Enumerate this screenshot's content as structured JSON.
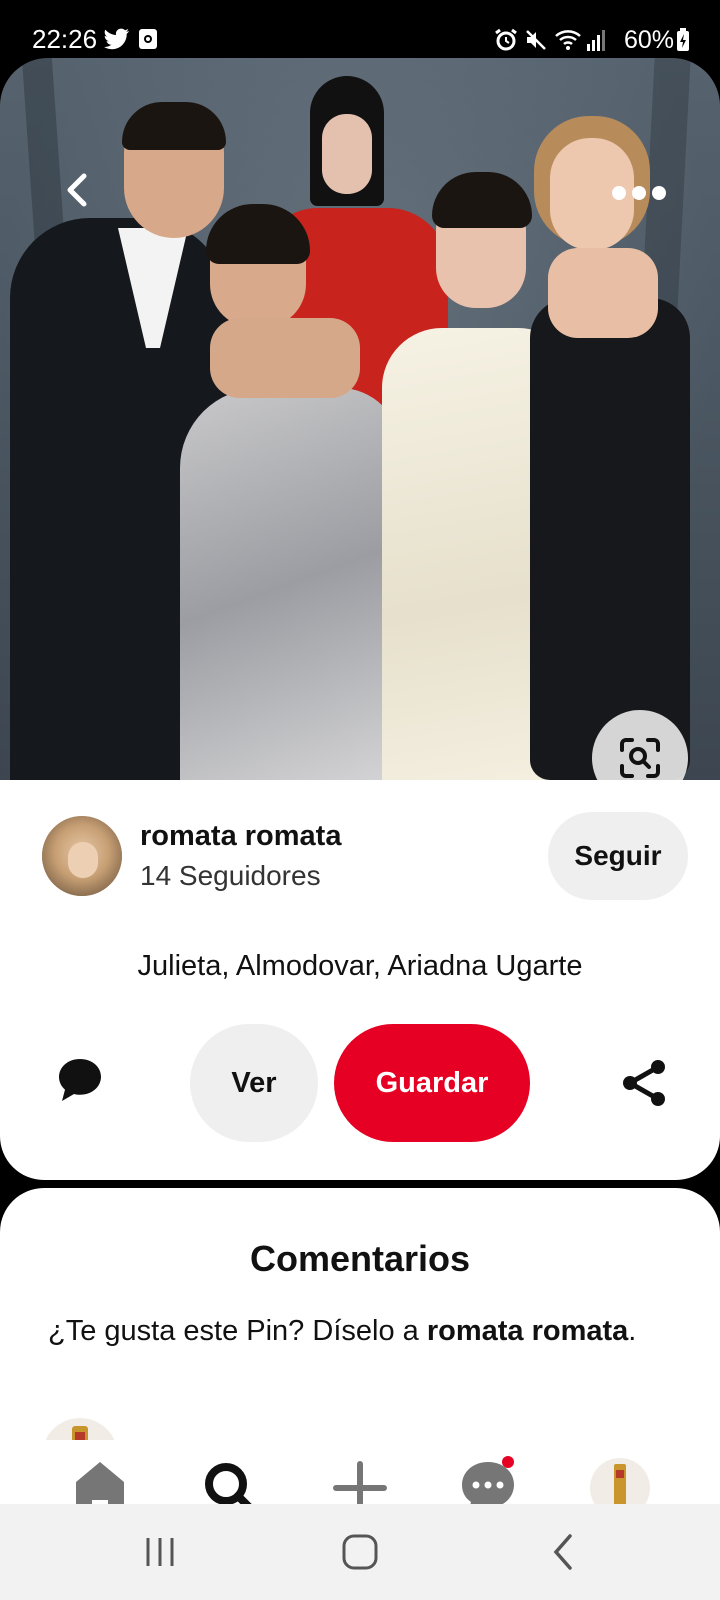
{
  "status_bar": {
    "time": "22:26",
    "battery": "60%",
    "icons": [
      "twitter-icon",
      "notification-icon",
      "alarm-icon",
      "mute-icon",
      "wifi-icon",
      "signal-icon",
      "battery-icon"
    ]
  },
  "pin": {
    "image_description_icon": "photo",
    "back_icon": "chevron-left-icon",
    "more_icon": "more-icon",
    "lens_icon": "visual-search-icon"
  },
  "creator": {
    "name": "romata romata",
    "followers": "14 Seguidores",
    "follow_label": "Seguir"
  },
  "description": "Julieta,  Almodovar,  Ariadna Ugarte",
  "actions": {
    "ver_label": "Ver",
    "save_label": "Guardar",
    "colors": {
      "save": "#e60023",
      "neutral": "#efefef"
    }
  },
  "comments": {
    "title": "Comentarios",
    "prompt_prefix": "¿Te gusta este Pin? Díselo a ",
    "prompt_name": "romata romata",
    "prompt_suffix": "."
  },
  "bottom_nav": {
    "items": [
      "home-icon",
      "search-icon",
      "create-icon",
      "messages-icon",
      "profile-icon"
    ],
    "active": "search-icon"
  }
}
